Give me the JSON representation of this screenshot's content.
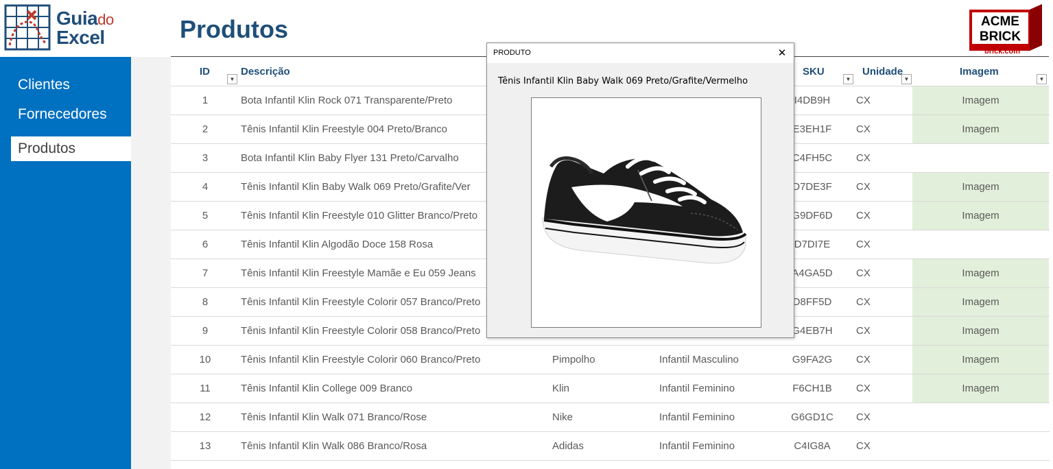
{
  "logo": {
    "part1": "Guia",
    "part2": "do",
    "part3": "Excel"
  },
  "page": {
    "title": "Produtos"
  },
  "acme": {
    "line1": "ACME",
    "line2": "BRICK",
    "line3": "brick.com"
  },
  "sidebar": {
    "items": [
      {
        "label": "Clientes",
        "active": false
      },
      {
        "label": "Fornecedores",
        "active": false
      },
      {
        "label": "Produtos",
        "active": true
      }
    ]
  },
  "table": {
    "headers": {
      "id": "ID",
      "desc": "Descrição",
      "sku": "SKU",
      "unit": "Unidade",
      "img": "Imagem"
    },
    "rows": [
      {
        "id": "1",
        "desc": "Bota Infantil Klin Rock 071 Transparente/Preto",
        "brand": "",
        "cat": "",
        "sku": "I4DB9H",
        "unit": "CX",
        "img": "Imagem"
      },
      {
        "id": "2",
        "desc": "Tênis Infantil Klin Freestyle 004 Preto/Branco",
        "brand": "",
        "cat": "",
        "sku": "E3EH1F",
        "unit": "CX",
        "img": "Imagem"
      },
      {
        "id": "3",
        "desc": "Bota Infantil Klin Baby Flyer 131 Preto/Carvalho",
        "brand": "",
        "cat": "",
        "sku": "C4FH5C",
        "unit": "CX",
        "img": ""
      },
      {
        "id": "4",
        "desc": "Tênis Infantil Klin Baby Walk 069 Preto/Grafite/Ver",
        "brand": "",
        "cat": "",
        "sku": "D7DE3F",
        "unit": "CX",
        "img": "Imagem"
      },
      {
        "id": "5",
        "desc": "Tênis Infantil Klin Freestyle 010 Glitter Branco/Preto",
        "brand": "",
        "cat": "",
        "sku": "G9DF6D",
        "unit": "CX",
        "img": "Imagem"
      },
      {
        "id": "6",
        "desc": "Tênis Infantil Klin Algodão Doce 158 Rosa",
        "brand": "",
        "cat": "",
        "sku": "D7DI7E",
        "unit": "CX",
        "img": ""
      },
      {
        "id": "7",
        "desc": "Tênis Infantil Klin Freestyle Mamãe e Eu 059 Jeans",
        "brand": "",
        "cat": "",
        "sku": "A4GA5D",
        "unit": "CX",
        "img": "Imagem"
      },
      {
        "id": "8",
        "desc": "Tênis Infantil Klin Freestyle Colorir 057 Branco/Preto",
        "brand": "",
        "cat": "",
        "sku": "D8FF5D",
        "unit": "CX",
        "img": "Imagem"
      },
      {
        "id": "9",
        "desc": "Tênis Infantil Klin Freestyle Colorir 058 Branco/Preto",
        "brand": "",
        "cat": "",
        "sku": "G4EB7H",
        "unit": "CX",
        "img": "Imagem"
      },
      {
        "id": "10",
        "desc": "Tênis Infantil Klin Freestyle Colorir 060 Branco/Preto",
        "brand": "Pimpolho",
        "cat": "Infantil Masculino",
        "sku": "G9FA2G",
        "unit": "CX",
        "img": "Imagem"
      },
      {
        "id": "11",
        "desc": "Tênis Infantil Klin College 009 Branco",
        "brand": "Klin",
        "cat": "Infantil Feminino",
        "sku": "F6CH1B",
        "unit": "CX",
        "img": "Imagem"
      },
      {
        "id": "12",
        "desc": "Tênis Infantil Klin Walk 071 Branco/Rose",
        "brand": "Nike",
        "cat": "Infantil Feminino",
        "sku": "G6GD1C",
        "unit": "CX",
        "img": ""
      },
      {
        "id": "13",
        "desc": "Tênis Infantil Klin Walk 086 Branco/Rosa",
        "brand": "Adidas",
        "cat": "Infantil Feminino",
        "sku": "C4IG8A",
        "unit": "CX",
        "img": ""
      }
    ]
  },
  "dialog": {
    "title": "PRODUTO",
    "close": "✕",
    "product_name": "Tênis Infantil Klin Baby Walk 069 Preto/Grafite/Vermelho"
  },
  "colors": {
    "sidebar": "#0070c0",
    "title": "#1f4e79",
    "image_cell": "#e2efda",
    "acme_red": "#c00000"
  }
}
